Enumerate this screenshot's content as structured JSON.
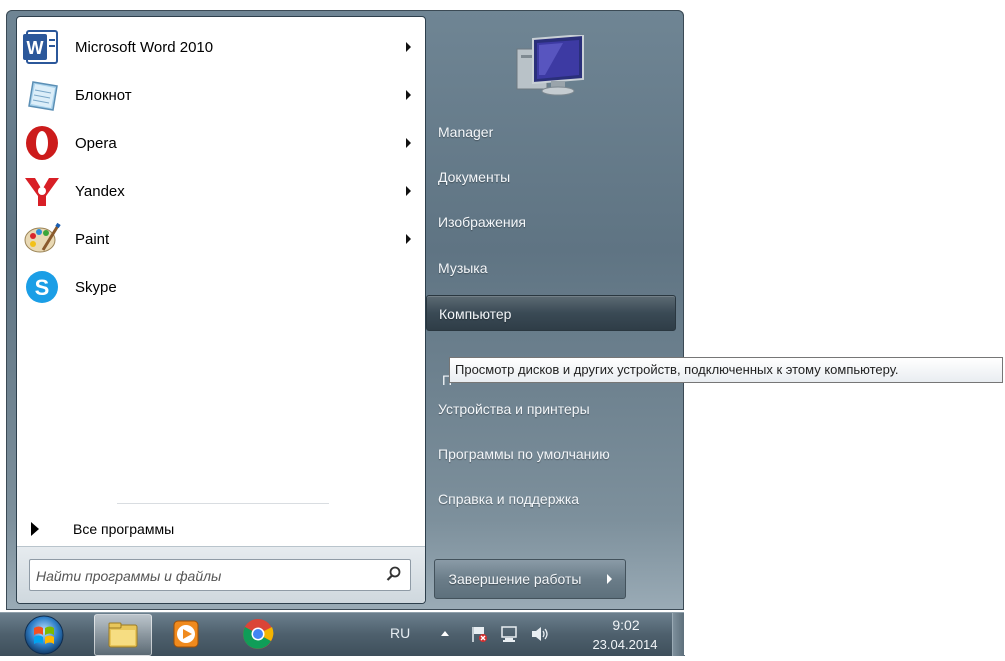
{
  "start_menu": {
    "programs": [
      {
        "label": "Microsoft Word 2010",
        "icon": "word-icon",
        "has_submenu": true
      },
      {
        "label": "Блокнот",
        "icon": "notepad-icon",
        "has_submenu": true
      },
      {
        "label": "Opera",
        "icon": "opera-icon",
        "has_submenu": true
      },
      {
        "label": "Yandex",
        "icon": "yandex-icon",
        "has_submenu": true
      },
      {
        "label": "Paint",
        "icon": "paint-icon",
        "has_submenu": true
      },
      {
        "label": "Skype",
        "icon": "skype-icon",
        "has_submenu": false
      }
    ],
    "all_programs_label": "Все программы",
    "search": {
      "placeholder": "Найти программы и файлы",
      "value": ""
    },
    "right_links": [
      {
        "label": "Manager"
      },
      {
        "label": "Документы"
      },
      {
        "label": "Изображения"
      },
      {
        "label": "Музыка"
      },
      {
        "label": "Компьютер",
        "highlighted": true
      },
      {
        "label": "П"
      },
      {
        "label": "Устройства и принтеры"
      },
      {
        "label": "Программы по умолчанию"
      },
      {
        "label": "Справка и поддержка"
      }
    ],
    "shutdown_label": "Завершение работы",
    "tooltip": "Просмотр дисков и других устройств, подключенных к этому компьютеру."
  },
  "taskbar": {
    "pinned": [
      "explorer-icon",
      "media-player-icon",
      "chrome-icon"
    ],
    "language": "RU",
    "time": "9:02",
    "date": "23.04.2014"
  }
}
